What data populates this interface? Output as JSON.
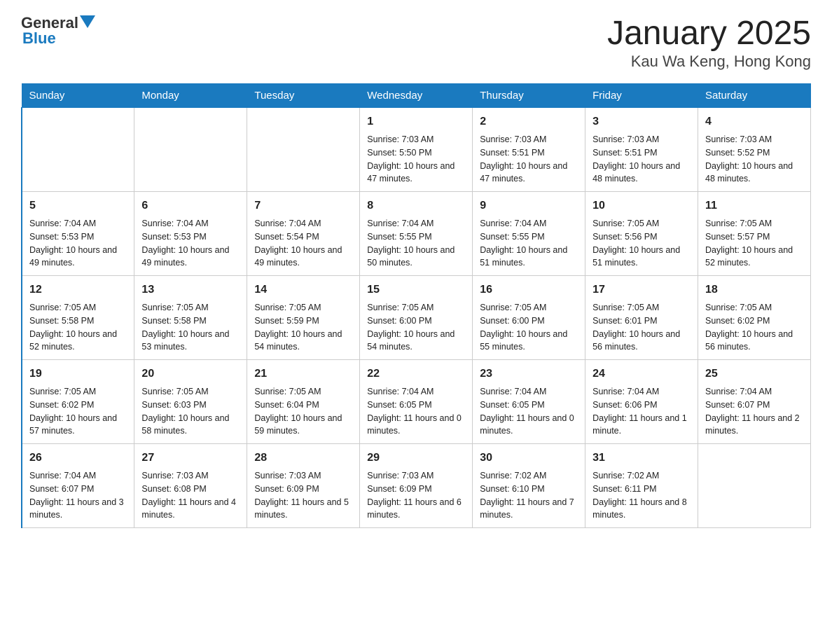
{
  "header": {
    "logo_general": "General",
    "logo_blue": "Blue",
    "title": "January 2025",
    "subtitle": "Kau Wa Keng, Hong Kong"
  },
  "calendar": {
    "days_of_week": [
      "Sunday",
      "Monday",
      "Tuesday",
      "Wednesday",
      "Thursday",
      "Friday",
      "Saturday"
    ],
    "weeks": [
      [
        {
          "day": "",
          "info": ""
        },
        {
          "day": "",
          "info": ""
        },
        {
          "day": "",
          "info": ""
        },
        {
          "day": "1",
          "info": "Sunrise: 7:03 AM\nSunset: 5:50 PM\nDaylight: 10 hours and 47 minutes."
        },
        {
          "day": "2",
          "info": "Sunrise: 7:03 AM\nSunset: 5:51 PM\nDaylight: 10 hours and 47 minutes."
        },
        {
          "day": "3",
          "info": "Sunrise: 7:03 AM\nSunset: 5:51 PM\nDaylight: 10 hours and 48 minutes."
        },
        {
          "day": "4",
          "info": "Sunrise: 7:03 AM\nSunset: 5:52 PM\nDaylight: 10 hours and 48 minutes."
        }
      ],
      [
        {
          "day": "5",
          "info": "Sunrise: 7:04 AM\nSunset: 5:53 PM\nDaylight: 10 hours and 49 minutes."
        },
        {
          "day": "6",
          "info": "Sunrise: 7:04 AM\nSunset: 5:53 PM\nDaylight: 10 hours and 49 minutes."
        },
        {
          "day": "7",
          "info": "Sunrise: 7:04 AM\nSunset: 5:54 PM\nDaylight: 10 hours and 49 minutes."
        },
        {
          "day": "8",
          "info": "Sunrise: 7:04 AM\nSunset: 5:55 PM\nDaylight: 10 hours and 50 minutes."
        },
        {
          "day": "9",
          "info": "Sunrise: 7:04 AM\nSunset: 5:55 PM\nDaylight: 10 hours and 51 minutes."
        },
        {
          "day": "10",
          "info": "Sunrise: 7:05 AM\nSunset: 5:56 PM\nDaylight: 10 hours and 51 minutes."
        },
        {
          "day": "11",
          "info": "Sunrise: 7:05 AM\nSunset: 5:57 PM\nDaylight: 10 hours and 52 minutes."
        }
      ],
      [
        {
          "day": "12",
          "info": "Sunrise: 7:05 AM\nSunset: 5:58 PM\nDaylight: 10 hours and 52 minutes."
        },
        {
          "day": "13",
          "info": "Sunrise: 7:05 AM\nSunset: 5:58 PM\nDaylight: 10 hours and 53 minutes."
        },
        {
          "day": "14",
          "info": "Sunrise: 7:05 AM\nSunset: 5:59 PM\nDaylight: 10 hours and 54 minutes."
        },
        {
          "day": "15",
          "info": "Sunrise: 7:05 AM\nSunset: 6:00 PM\nDaylight: 10 hours and 54 minutes."
        },
        {
          "day": "16",
          "info": "Sunrise: 7:05 AM\nSunset: 6:00 PM\nDaylight: 10 hours and 55 minutes."
        },
        {
          "day": "17",
          "info": "Sunrise: 7:05 AM\nSunset: 6:01 PM\nDaylight: 10 hours and 56 minutes."
        },
        {
          "day": "18",
          "info": "Sunrise: 7:05 AM\nSunset: 6:02 PM\nDaylight: 10 hours and 56 minutes."
        }
      ],
      [
        {
          "day": "19",
          "info": "Sunrise: 7:05 AM\nSunset: 6:02 PM\nDaylight: 10 hours and 57 minutes."
        },
        {
          "day": "20",
          "info": "Sunrise: 7:05 AM\nSunset: 6:03 PM\nDaylight: 10 hours and 58 minutes."
        },
        {
          "day": "21",
          "info": "Sunrise: 7:05 AM\nSunset: 6:04 PM\nDaylight: 10 hours and 59 minutes."
        },
        {
          "day": "22",
          "info": "Sunrise: 7:04 AM\nSunset: 6:05 PM\nDaylight: 11 hours and 0 minutes."
        },
        {
          "day": "23",
          "info": "Sunrise: 7:04 AM\nSunset: 6:05 PM\nDaylight: 11 hours and 0 minutes."
        },
        {
          "day": "24",
          "info": "Sunrise: 7:04 AM\nSunset: 6:06 PM\nDaylight: 11 hours and 1 minute."
        },
        {
          "day": "25",
          "info": "Sunrise: 7:04 AM\nSunset: 6:07 PM\nDaylight: 11 hours and 2 minutes."
        }
      ],
      [
        {
          "day": "26",
          "info": "Sunrise: 7:04 AM\nSunset: 6:07 PM\nDaylight: 11 hours and 3 minutes."
        },
        {
          "day": "27",
          "info": "Sunrise: 7:03 AM\nSunset: 6:08 PM\nDaylight: 11 hours and 4 minutes."
        },
        {
          "day": "28",
          "info": "Sunrise: 7:03 AM\nSunset: 6:09 PM\nDaylight: 11 hours and 5 minutes."
        },
        {
          "day": "29",
          "info": "Sunrise: 7:03 AM\nSunset: 6:09 PM\nDaylight: 11 hours and 6 minutes."
        },
        {
          "day": "30",
          "info": "Sunrise: 7:02 AM\nSunset: 6:10 PM\nDaylight: 11 hours and 7 minutes."
        },
        {
          "day": "31",
          "info": "Sunrise: 7:02 AM\nSunset: 6:11 PM\nDaylight: 11 hours and 8 minutes."
        },
        {
          "day": "",
          "info": ""
        }
      ]
    ]
  }
}
